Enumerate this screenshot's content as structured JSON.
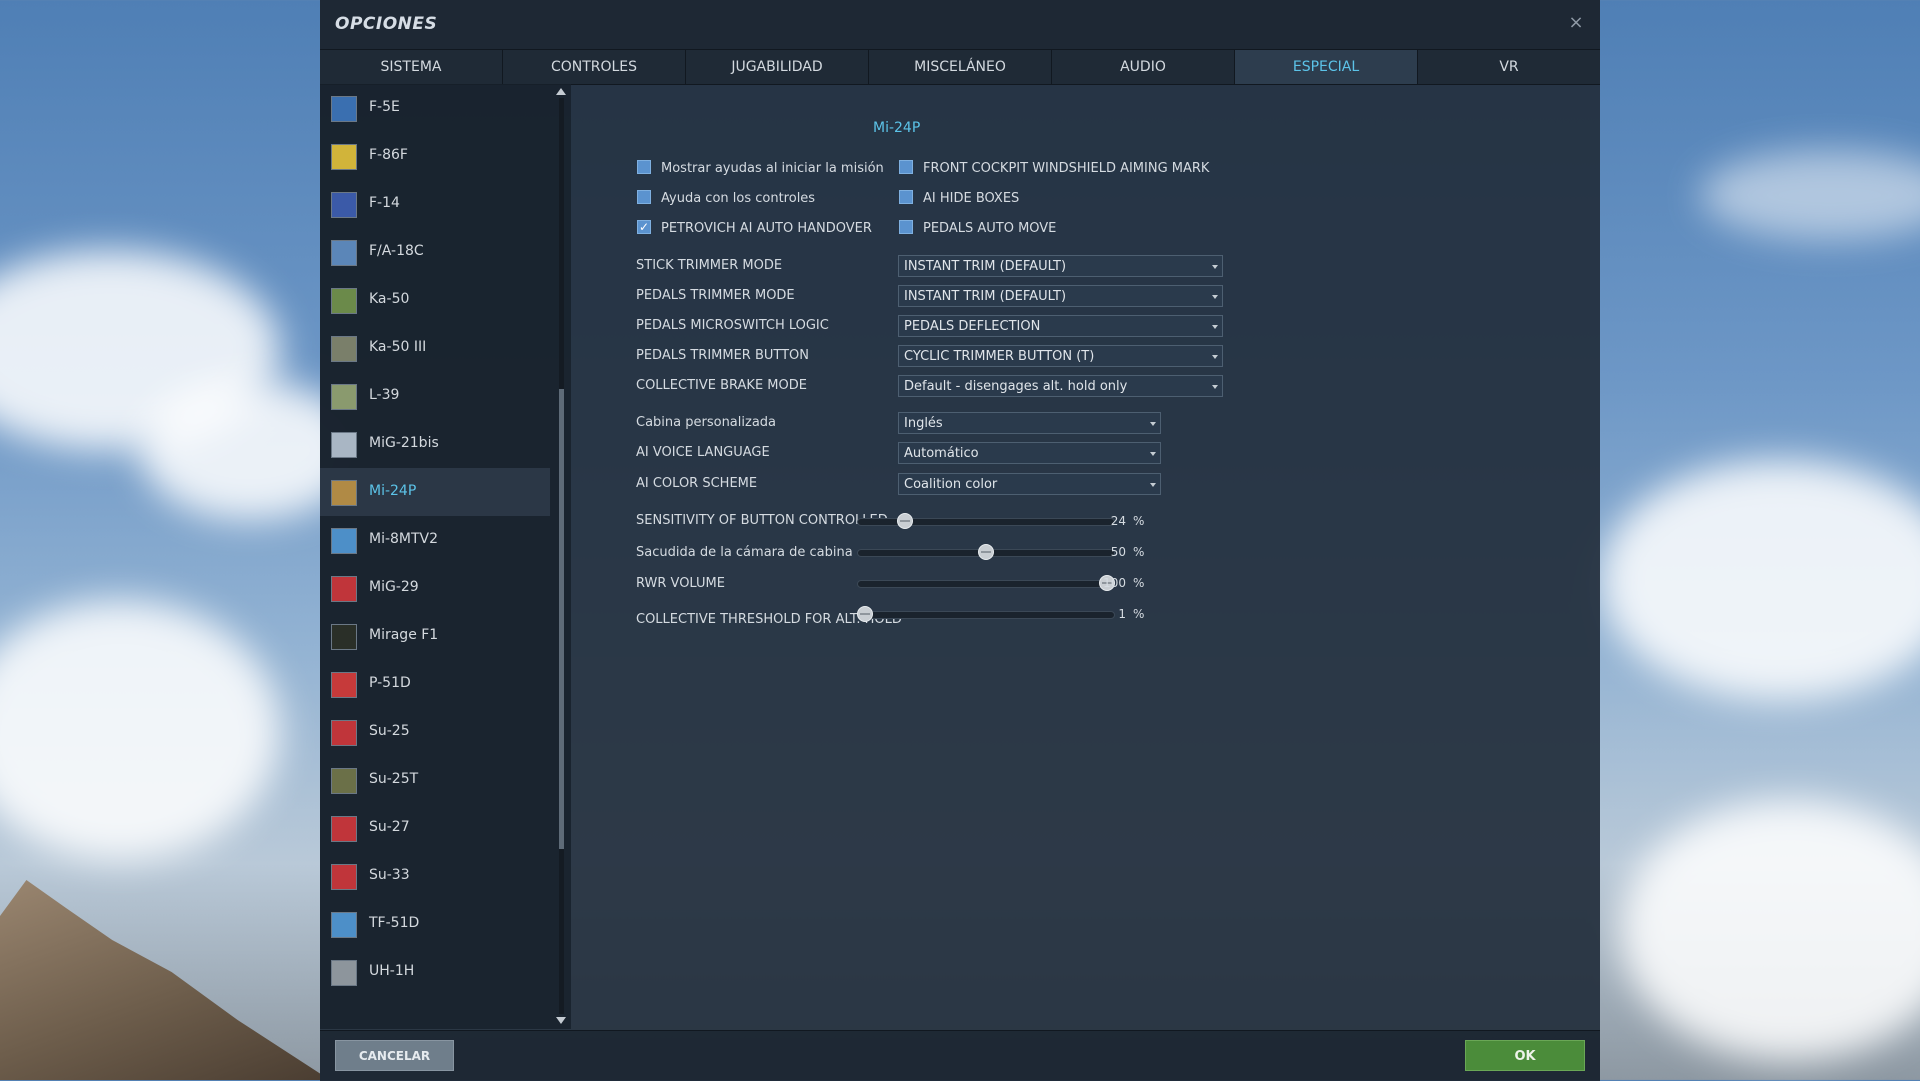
{
  "dialog": {
    "title": "OPCIONES",
    "close_icon": "×"
  },
  "tabs": [
    {
      "label": "SISTEMA"
    },
    {
      "label": "CONTROLES"
    },
    {
      "label": "JUGABILIDAD"
    },
    {
      "label": "MISCELÁNEO"
    },
    {
      "label": "AUDIO"
    },
    {
      "label": "ESPECIAL",
      "active": true
    },
    {
      "label": "VR"
    }
  ],
  "sidebar": {
    "items": [
      {
        "label": "F-5E"
      },
      {
        "label": "F-86F"
      },
      {
        "label": "F-14"
      },
      {
        "label": "F/A-18C"
      },
      {
        "label": "Ka-50"
      },
      {
        "label": "Ka-50 III"
      },
      {
        "label": "L-39"
      },
      {
        "label": "MiG-21bis"
      },
      {
        "label": "Mi-24P",
        "active": true
      },
      {
        "label": "Mi-8MTV2"
      },
      {
        "label": "MiG-29"
      },
      {
        "label": "Mirage F1"
      },
      {
        "label": "P-51D"
      },
      {
        "label": "Su-25"
      },
      {
        "label": "Su-25T"
      },
      {
        "label": "Su-27"
      },
      {
        "label": "Su-33"
      },
      {
        "label": "TF-51D"
      },
      {
        "label": "UH-1H"
      }
    ]
  },
  "content": {
    "section_title": "Mi-24P",
    "checkboxes_left": [
      {
        "label": "Mostrar ayudas al iniciar la misión",
        "checked": false
      },
      {
        "label": "Ayuda con los controles",
        "checked": false
      },
      {
        "label": "PETROVICH AI AUTO HANDOVER",
        "checked": true
      }
    ],
    "checkboxes_right": [
      {
        "label": "FRONT COCKPIT WINDSHIELD AIMING MARK",
        "checked": false
      },
      {
        "label": "AI HIDE BOXES",
        "checked": false
      },
      {
        "label": "PEDALS AUTO MOVE",
        "checked": false
      }
    ],
    "dropdowns_wide": [
      {
        "label": "STICK TRIMMER MODE",
        "value": "INSTANT TRIM (DEFAULT)"
      },
      {
        "label": "PEDALS TRIMMER MODE",
        "value": "INSTANT TRIM (DEFAULT)"
      },
      {
        "label": "PEDALS MICROSWITCH LOGIC",
        "value": "PEDALS DEFLECTION"
      },
      {
        "label": "PEDALS TRIMMER BUTTON",
        "value": "CYCLIC TRIMMER BUTTON (T)"
      },
      {
        "label": "COLLECTIVE BRAKE MODE",
        "value": "Default - disengages alt. hold only"
      }
    ],
    "dropdowns_narrow": [
      {
        "label": "Cabina personalizada",
        "value": "Inglés"
      },
      {
        "label": "AI VOICE LANGUAGE",
        "value": "Automático"
      },
      {
        "label": "AI COLOR SCHEME",
        "value": "Coalition color"
      }
    ],
    "sliders": [
      {
        "label": "SENSITIVITY OF BUTTON CONTROLLED PED",
        "value": "24",
        "unit": "%",
        "fraction": 0.166
      },
      {
        "label": "Sacudida de la cámara de cabina",
        "value": "50",
        "unit": "%",
        "fraction": 0.5
      },
      {
        "label": "RWR VOLUME",
        "value": "100",
        "unit": "%",
        "fraction": 1.0
      },
      {
        "label": "COLLECTIVE THRESHOLD FOR ALT. HOLD",
        "value": "1",
        "unit": "%",
        "fraction": 0.0
      }
    ]
  },
  "footer": {
    "cancel_label": "CANCELAR",
    "ok_label": "OK"
  },
  "colors": {
    "accent": "#5cc3e8",
    "ok_button": "#4b8c3a",
    "cancel_button": "#6f7e8b"
  }
}
